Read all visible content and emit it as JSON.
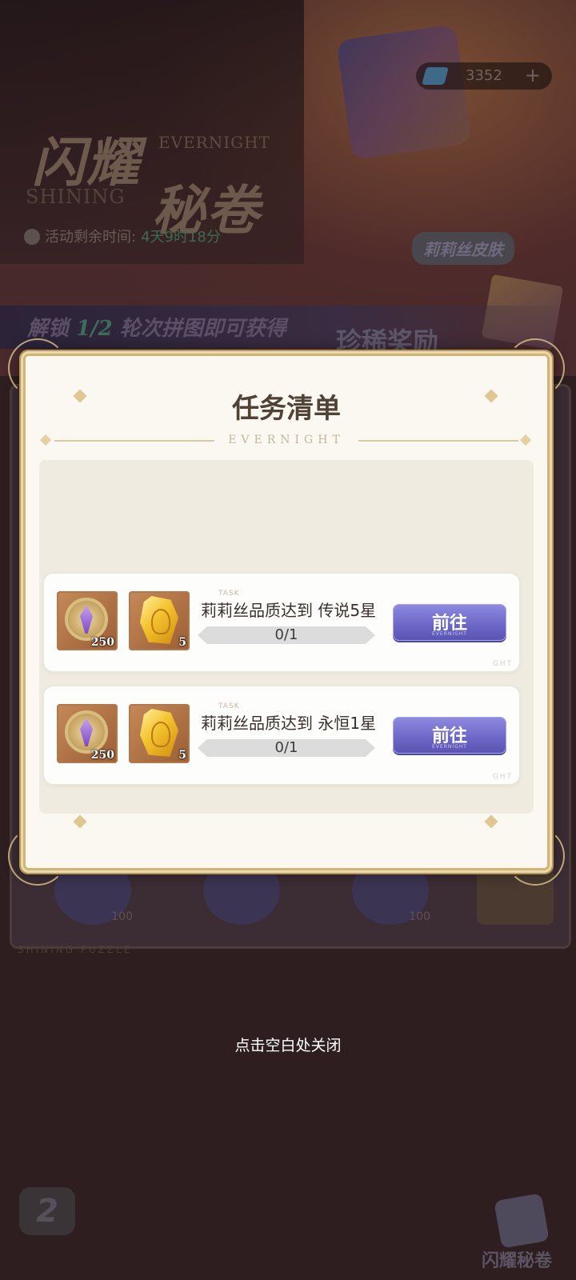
{
  "background": {
    "event_title_line1": "闪耀",
    "event_title_line2": "秘卷",
    "event_subtitle_en1": "EVERNIGHT",
    "event_subtitle_en2": "SHINING",
    "timer_label": "活动剩余时间:",
    "timer_value": "4天9时18分",
    "currency_value": "3352",
    "currency_plus": "+",
    "skin_tag": "莉莉丝皮肤",
    "banner_text_prefix": "解锁 ",
    "banner_text_highlight": "1/2",
    "banner_text_suffix": " 轮次拼图即可获得",
    "banner_rare": "珍稀奖励",
    "puzzle_slots": [
      {
        "qty": "100"
      },
      {
        "qty": ""
      },
      {
        "qty": "100"
      },
      {
        "qty": ""
      }
    ],
    "board_footer": "SHINING PUZZLE",
    "logo_text": "2",
    "corner_button_label": "闪耀秘卷"
  },
  "dialog": {
    "title": "任务清单",
    "divider_word": "EVERNIGHT",
    "tasks": [
      {
        "tag": "TASK",
        "description": "莉莉丝品质达到 传说5星",
        "progress_text": "0/1",
        "progress": 0,
        "rewards": [
          {
            "icon": "purple-rune-coin-icon",
            "qty": "250"
          },
          {
            "icon": "gold-crystal-icon",
            "qty": "5"
          }
        ],
        "button_label": "前往",
        "button_sub": "EVERNIGHT",
        "card_tag": "GHT"
      },
      {
        "tag": "TASK",
        "description": "莉莉丝品质达到 永恒1星",
        "progress_text": "0/1",
        "progress": 0,
        "rewards": [
          {
            "icon": "purple-rune-coin-icon",
            "qty": "250"
          },
          {
            "icon": "gold-crystal-icon",
            "qty": "5"
          }
        ],
        "button_label": "前往",
        "button_sub": "EVERNIGHT",
        "card_tag": "GHT"
      }
    ]
  },
  "close_hint": "点击空白处关闭",
  "colors": {
    "accent_button": "#6b66c6",
    "dialog_border": "#d3b476",
    "backdrop": "#2e1e20"
  }
}
